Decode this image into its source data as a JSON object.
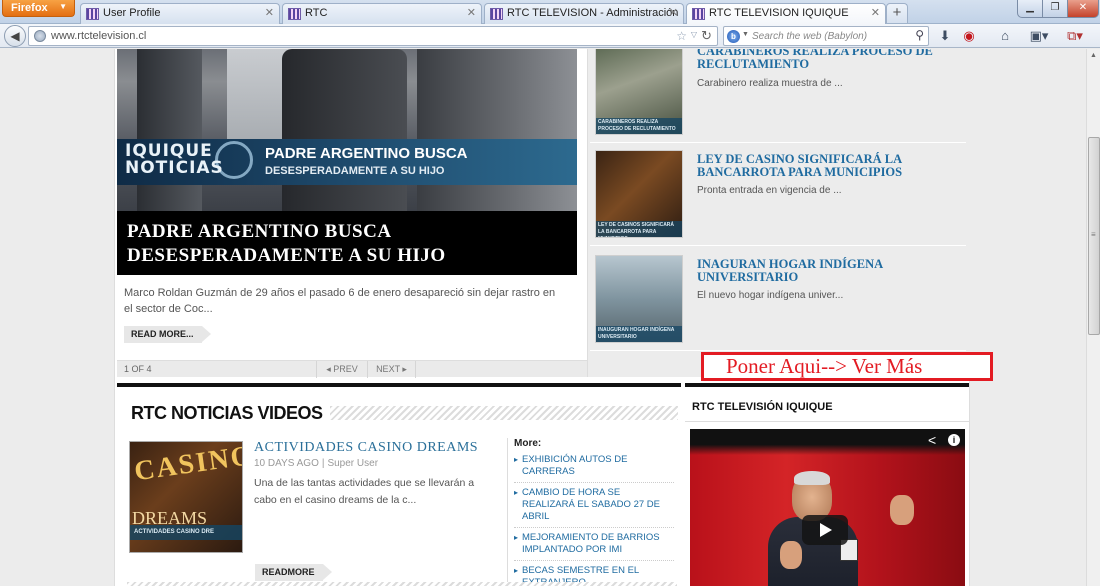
{
  "browser": {
    "firefox_label": "Firefox",
    "tabs": [
      {
        "title": "User Profile",
        "active": false
      },
      {
        "title": "RTC",
        "active": false
      },
      {
        "title": "RTC TELEVISION - Administración",
        "active": false
      },
      {
        "title": "RTC TELEVISION IQUIQUE",
        "active": true
      }
    ],
    "url": "www.rtctelevision.cl",
    "search_placeholder": "Search the web (Babylon)",
    "new_tab": "+",
    "tab_close_glyph": "✕"
  },
  "featured": {
    "image_brand": "IQUIQUE NOTICIAS",
    "image_headline_1": "PADRE ARGENTINO BUSCA",
    "image_headline_2": "DESESPERADAMENTE A SU HIJO",
    "title": "PADRE ARGENTINO BUSCA DESESPERADAMENTE A SU HIJO",
    "summary": "Marco Roldan Guzmán de 29 años el pasado 6 de enero desapareció sin dejar rastro en el sector de Coc...",
    "read_more": "READ MORE...",
    "pager": {
      "count": "1 OF 4",
      "prev": "◂ PREV",
      "next": "NEXT ▸"
    }
  },
  "news_list": [
    {
      "title": "CARABINEROS REALIZA PROCESO DE RECLUTAMIENTO",
      "desc": "Carabinero realiza muestra de ...",
      "caption": "CARABINEROS REALIZA PROCESO DE RECLUTAMIENTO"
    },
    {
      "title": "LEY DE CASINO SIGNIFICARÁ LA BANCARROTA PARA MUNICIPIOS",
      "desc": "Pronta entrada en vigencia de ...",
      "caption": "LEY DE CASINOS SIGNIFICARÁ LA BANCARROTA PARA MUNICIPIOS"
    },
    {
      "title": "INAGURAN HOGAR INDÍGENA UNIVERSITARIO",
      "desc": "El nuevo hogar indígena univer...",
      "caption": "INAUGURAN HOGAR INDÍGENA UNIVERSITARIO"
    }
  ],
  "annotation": "Poner Aqui--> Ver Más",
  "videos": {
    "heading": "RTC NOTICIAS VIDEOS",
    "item": {
      "title": "ACTIVIDADES CASINO DREAMS",
      "date": "10 DAYS AGO",
      "author": "Super User",
      "desc": "Una de las tantas actividades que se llevarán a cabo en el casino dreams de la c...",
      "read_more": "READMORE",
      "thumb_caption": "ACTIVIDADES CASINO DRE"
    },
    "more_label": "More:",
    "more_links": [
      "EXHIBICIÓN AUTOS DE CARRERAS",
      "CAMBIO DE HORA SE REALIZARÁ EL SABADO 27 DE ABRIL",
      "MEJORAMIENTO DE BARRIOS IMPLANTADO POR IMI",
      "BECAS SEMESTRE EN EL EXTRANJERO"
    ]
  },
  "tv": {
    "heading": "RTC TELEVISIÓN IQUIQUE"
  },
  "colors": {
    "link": "#1f6ba0",
    "annotation": "#e31b23",
    "firefox": "#e46f12"
  }
}
